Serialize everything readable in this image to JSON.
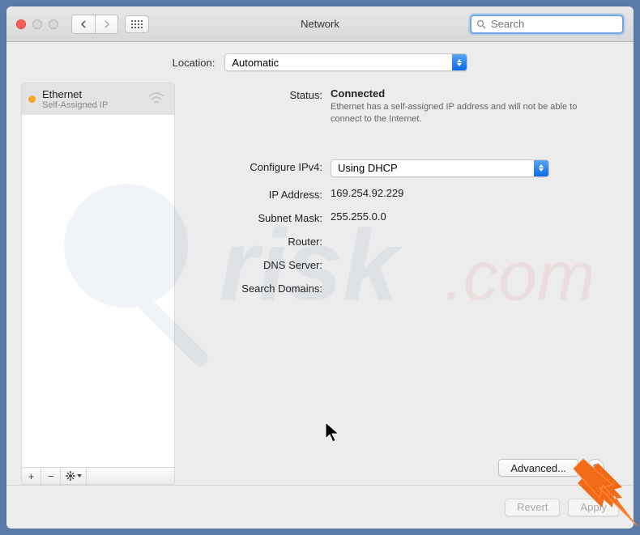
{
  "window": {
    "title": "Network"
  },
  "search": {
    "placeholder": "Search"
  },
  "location": {
    "label": "Location:",
    "value": "Automatic"
  },
  "sidebar": {
    "items": [
      {
        "name": "Ethernet",
        "subtitle": "Self-Assigned IP",
        "status_color": "#f6a623",
        "icon": "ethernet-icon"
      }
    ],
    "toolbar": {
      "add": "+",
      "remove": "−",
      "gear": "✻"
    }
  },
  "detail": {
    "status": {
      "label": "Status:",
      "value": "Connected",
      "message": "Ethernet has a self-assigned IP address and will not be able to connect to the Internet."
    },
    "configure": {
      "label": "Configure IPv4:",
      "value": "Using DHCP"
    },
    "ip": {
      "label": "IP Address:",
      "value": "169.254.92.229"
    },
    "subnet": {
      "label": "Subnet Mask:",
      "value": "255.255.0.0"
    },
    "router": {
      "label": "Router:",
      "value": ""
    },
    "dns": {
      "label": "DNS Server:",
      "value": ""
    },
    "search_domains": {
      "label": "Search Domains:",
      "value": ""
    }
  },
  "buttons": {
    "advanced": "Advanced...",
    "help": "?",
    "revert": "Revert",
    "apply": "Apply"
  },
  "colors": {
    "accent": "#0a6be8",
    "arrow": "#f06a18",
    "status_dot": "#f6a623"
  }
}
